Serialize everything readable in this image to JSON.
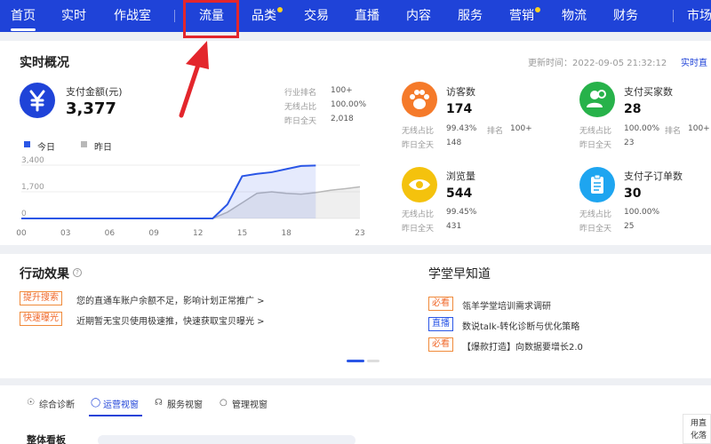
{
  "nav": {
    "items": [
      {
        "label": "首页"
      },
      {
        "label": "实时"
      },
      {
        "label": "作战室"
      },
      {
        "label": "流量"
      },
      {
        "label": "品类"
      },
      {
        "label": "交易"
      },
      {
        "label": "直播"
      },
      {
        "label": "内容"
      },
      {
        "label": "服务"
      },
      {
        "label": "营销"
      },
      {
        "label": "物流"
      },
      {
        "label": "财务"
      },
      {
        "label": "市场"
      }
    ]
  },
  "realtime": {
    "title": "实时概况",
    "update_time": "更新时间：2022-09-05 21:32:12",
    "link": "实时直",
    "payment": {
      "label": "支付金额(元)",
      "value": "3,377",
      "icon": "yen-icon",
      "stats": [
        {
          "label": "行业排名",
          "value": "100+"
        },
        {
          "label": "无线占比",
          "value": "100.00%"
        },
        {
          "label": "昨日全天",
          "value": "2,018"
        }
      ]
    },
    "legend": {
      "today": "今日",
      "yesterday": "昨日"
    },
    "chart_data": {
      "type": "area",
      "x": [
        "00",
        "01",
        "02",
        "03",
        "04",
        "05",
        "06",
        "07",
        "08",
        "09",
        "10",
        "11",
        "12",
        "13",
        "14",
        "15",
        "16",
        "17",
        "18",
        "19",
        "20",
        "21",
        "22",
        "23"
      ],
      "x_tick_labels": [
        "00",
        "03",
        "06",
        "09",
        "12",
        "15",
        "18",
        "23"
      ],
      "y_tick_labels": [
        "3,400",
        "1,700",
        "0"
      ],
      "ylim": [
        0,
        3400
      ],
      "series": [
        {
          "name": "今日",
          "color": "#2a56e6",
          "values": [
            0,
            0,
            0,
            0,
            0,
            0,
            0,
            0,
            0,
            0,
            0,
            0,
            0,
            0,
            900,
            2700,
            2850,
            2950,
            3150,
            3350,
            3377,
            3377,
            3377,
            3377
          ]
        },
        {
          "name": "昨日",
          "color": "#b8b8b8",
          "values": [
            0,
            0,
            0,
            0,
            0,
            0,
            0,
            0,
            0,
            0,
            0,
            0,
            0,
            0,
            400,
            1000,
            1600,
            1700,
            1600,
            1550,
            1650,
            1800,
            1900,
            2018
          ]
        }
      ]
    },
    "metrics": [
      {
        "key": "visitors",
        "label": "访客数",
        "value": "174",
        "icon": "paw-icon",
        "color": "#f57a2a",
        "stats": [
          {
            "label": "无线占比",
            "value": "99.43%"
          },
          {
            "label": "排名",
            "value": "100+"
          },
          {
            "label": "昨日全天",
            "value": "148"
          }
        ]
      },
      {
        "key": "buyers",
        "label": "支付买家数",
        "value": "28",
        "icon": "users-icon",
        "color": "#27b24a",
        "stats": [
          {
            "label": "无线占比",
            "value": "100.00%"
          },
          {
            "label": "排名",
            "value": "100+"
          },
          {
            "label": "昨日全天",
            "value": "23"
          }
        ]
      },
      {
        "key": "views",
        "label": "浏览量",
        "value": "544",
        "icon": "eye-icon",
        "color": "#f4c20d",
        "stats": [
          {
            "label": "无线占比",
            "value": "99.45%"
          },
          {
            "label": "昨日全天",
            "value": "431"
          }
        ]
      },
      {
        "key": "orders",
        "label": "支付子订单数",
        "value": "30",
        "icon": "clipboard-icon",
        "color": "#1ea5f0",
        "stats": [
          {
            "label": "无线占比",
            "value": "100.00%"
          },
          {
            "label": "昨日全天",
            "value": "25"
          }
        ]
      }
    ]
  },
  "action": {
    "title": "行动效果",
    "items": [
      {
        "tag": "提升搜索",
        "text": "您的直通车账户余额不足，影响计划正常推广 >"
      },
      {
        "tag": "快速曝光",
        "text": "近期暂无宝贝使用极速推，快速获取宝贝曝光 >"
      }
    ]
  },
  "school": {
    "title": "学堂早知道",
    "items": [
      {
        "tag": "必看",
        "text": "瓴羊学堂培训需求调研"
      },
      {
        "tag": "直播",
        "text": "数说talk-转化诊断与优化策略"
      },
      {
        "tag": "必看",
        "text": "【爆款打造】向数据要增长2.0"
      }
    ]
  },
  "subtabs": [
    {
      "label": "综合诊断",
      "icon": "diagnosis-icon"
    },
    {
      "label": "运营视窗",
      "icon": "shield-icon"
    },
    {
      "label": "服务视窗",
      "icon": "headset-icon"
    },
    {
      "label": "管理视窗",
      "icon": "medal-icon"
    }
  ],
  "bottom": {
    "title": "整体看板",
    "side_text": "用直",
    "side_text2": "化落"
  },
  "colors": {
    "nav_bg": "#1f43d8",
    "accent": "#1f43d8",
    "annotation": "#e3262c"
  }
}
